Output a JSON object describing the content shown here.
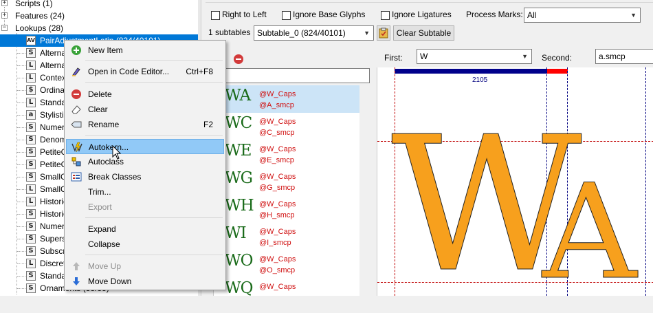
{
  "tree": {
    "rows": [
      {
        "label": "Scripts (1)",
        "expander": "+"
      },
      {
        "label": "Features (24)",
        "expander": "+"
      },
      {
        "label": "Lookups (28)",
        "expander": "−"
      },
      {
        "label": "PairAdjustmentLatin (824/40101)",
        "icon": "AV"
      },
      {
        "label": "Alternates",
        "icon": "S"
      },
      {
        "label": "Alternates",
        "icon": "L"
      },
      {
        "label": "Context",
        "icon": "L"
      },
      {
        "label": "Ordinals",
        "icon": "$"
      },
      {
        "label": "Standard",
        "icon": "L"
      },
      {
        "label": "Stylistic",
        "icon": "a"
      },
      {
        "label": "Numerators",
        "icon": "S"
      },
      {
        "label": "Denominators",
        "icon": "S"
      },
      {
        "label": "PetiteCaps",
        "icon": "S"
      },
      {
        "label": "PetiteCaps",
        "icon": "S"
      },
      {
        "label": "SmallCaps",
        "icon": "S"
      },
      {
        "label": "SmallCaps",
        "icon": "L"
      },
      {
        "label": "Historical",
        "icon": "L"
      },
      {
        "label": "Historical",
        "icon": "S"
      },
      {
        "label": "Numerals",
        "icon": "S"
      },
      {
        "label": "Superscript",
        "icon": "S"
      },
      {
        "label": "Subscript",
        "icon": "S"
      },
      {
        "label": "Discretionary",
        "icon": "L"
      },
      {
        "label": "Standard",
        "icon": "S"
      },
      {
        "label": "Ornaments (33/33)",
        "icon": "S"
      }
    ]
  },
  "top": {
    "right_to_left": "Right to Left",
    "ignore_base": "Ignore Base Glyphs",
    "ignore_lig": "Ignore Ligatures",
    "process_marks_label": "Process Marks:",
    "process_marks_value": "All",
    "subtables_count": "1 subtables",
    "subtable_value": "Subtable_0 (824/40101)",
    "clear_subtable": "Clear Subtable"
  },
  "pairs": [
    {
      "glyphs": "WA",
      "first": "@W_Caps",
      "second": "@A_smcp"
    },
    {
      "glyphs": "WC",
      "first": "@W_Caps",
      "second": "@C_smcp"
    },
    {
      "glyphs": "WE",
      "first": "@W_Caps",
      "second": "@E_smcp"
    },
    {
      "glyphs": "WG",
      "first": "@W_Caps",
      "second": "@G_smcp"
    },
    {
      "glyphs": "WH",
      "first": "@W_Caps",
      "second": "@H_smcp"
    },
    {
      "glyphs": "WI",
      "first": "@W_Caps",
      "second": "@I_smcp"
    },
    {
      "glyphs": "WO",
      "first": "@W_Caps",
      "second": "@O_smcp"
    },
    {
      "glyphs": "WQ",
      "first": "@W_Caps",
      "second": ""
    }
  ],
  "preview": {
    "first_label": "First:",
    "first_value": "W",
    "second_label": "Second:",
    "second_value": "a.smcp",
    "advance": "2105",
    "glyph_left": "W",
    "glyph_right": "A",
    "glyph_color": "#f7a01d"
  },
  "menu": {
    "new_item": "New Item",
    "open_editor": "Open in Code Editor...",
    "open_editor_sc": "Ctrl+F8",
    "delete": "Delete",
    "clear": "Clear",
    "rename": "Rename",
    "rename_sc": "F2",
    "autokern": "Autokern...",
    "autoclass": "Autoclass",
    "break_classes": "Break Classes",
    "trim": "Trim...",
    "export": "Export",
    "expand": "Expand",
    "collapse": "Collapse",
    "move_up": "Move Up",
    "move_down": "Move Down"
  },
  "colors": {
    "selection": "#0078d7",
    "menu_highlight": "#91c9f7",
    "class_text": "#d01010",
    "glyph_green": "#1a6b1a",
    "advance_bar": "#00008b",
    "kern_bar": "#ff0000"
  }
}
